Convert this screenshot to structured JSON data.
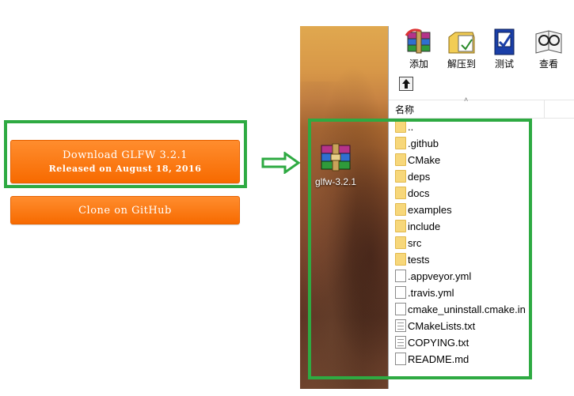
{
  "website": {
    "download_button": {
      "line1": "Download GLFW 3.2.1",
      "line2": "Released on August 18, 2016"
    },
    "clone_button": "Clone on GitHub",
    "accent_color": "#ff7f1a",
    "highlight_color": "#2eaa42"
  },
  "desktop": {
    "file_label": "glfw-3.2.1",
    "file_icon": "winrar-archive-icon"
  },
  "winrar": {
    "toolbar": [
      {
        "label": "添加",
        "icon": "add-archive-icon"
      },
      {
        "label": "解压到",
        "icon": "extract-to-icon"
      },
      {
        "label": "测试",
        "icon": "test-icon"
      },
      {
        "label": "查看",
        "icon": "view-icon"
      }
    ],
    "column_name": "名称",
    "files": [
      {
        "name": "..",
        "type": "folder"
      },
      {
        "name": ".github",
        "type": "folder"
      },
      {
        "name": "CMake",
        "type": "folder"
      },
      {
        "name": "deps",
        "type": "folder"
      },
      {
        "name": "docs",
        "type": "folder"
      },
      {
        "name": "examples",
        "type": "folder"
      },
      {
        "name": "include",
        "type": "folder"
      },
      {
        "name": "src",
        "type": "folder"
      },
      {
        "name": "tests",
        "type": "folder"
      },
      {
        "name": ".appveyor.yml",
        "type": "file"
      },
      {
        "name": ".travis.yml",
        "type": "file"
      },
      {
        "name": "cmake_uninstall.cmake.in",
        "type": "file"
      },
      {
        "name": "CMakeLists.txt",
        "type": "text"
      },
      {
        "name": "COPYING.txt",
        "type": "text"
      },
      {
        "name": "README.md",
        "type": "file"
      }
    ]
  }
}
